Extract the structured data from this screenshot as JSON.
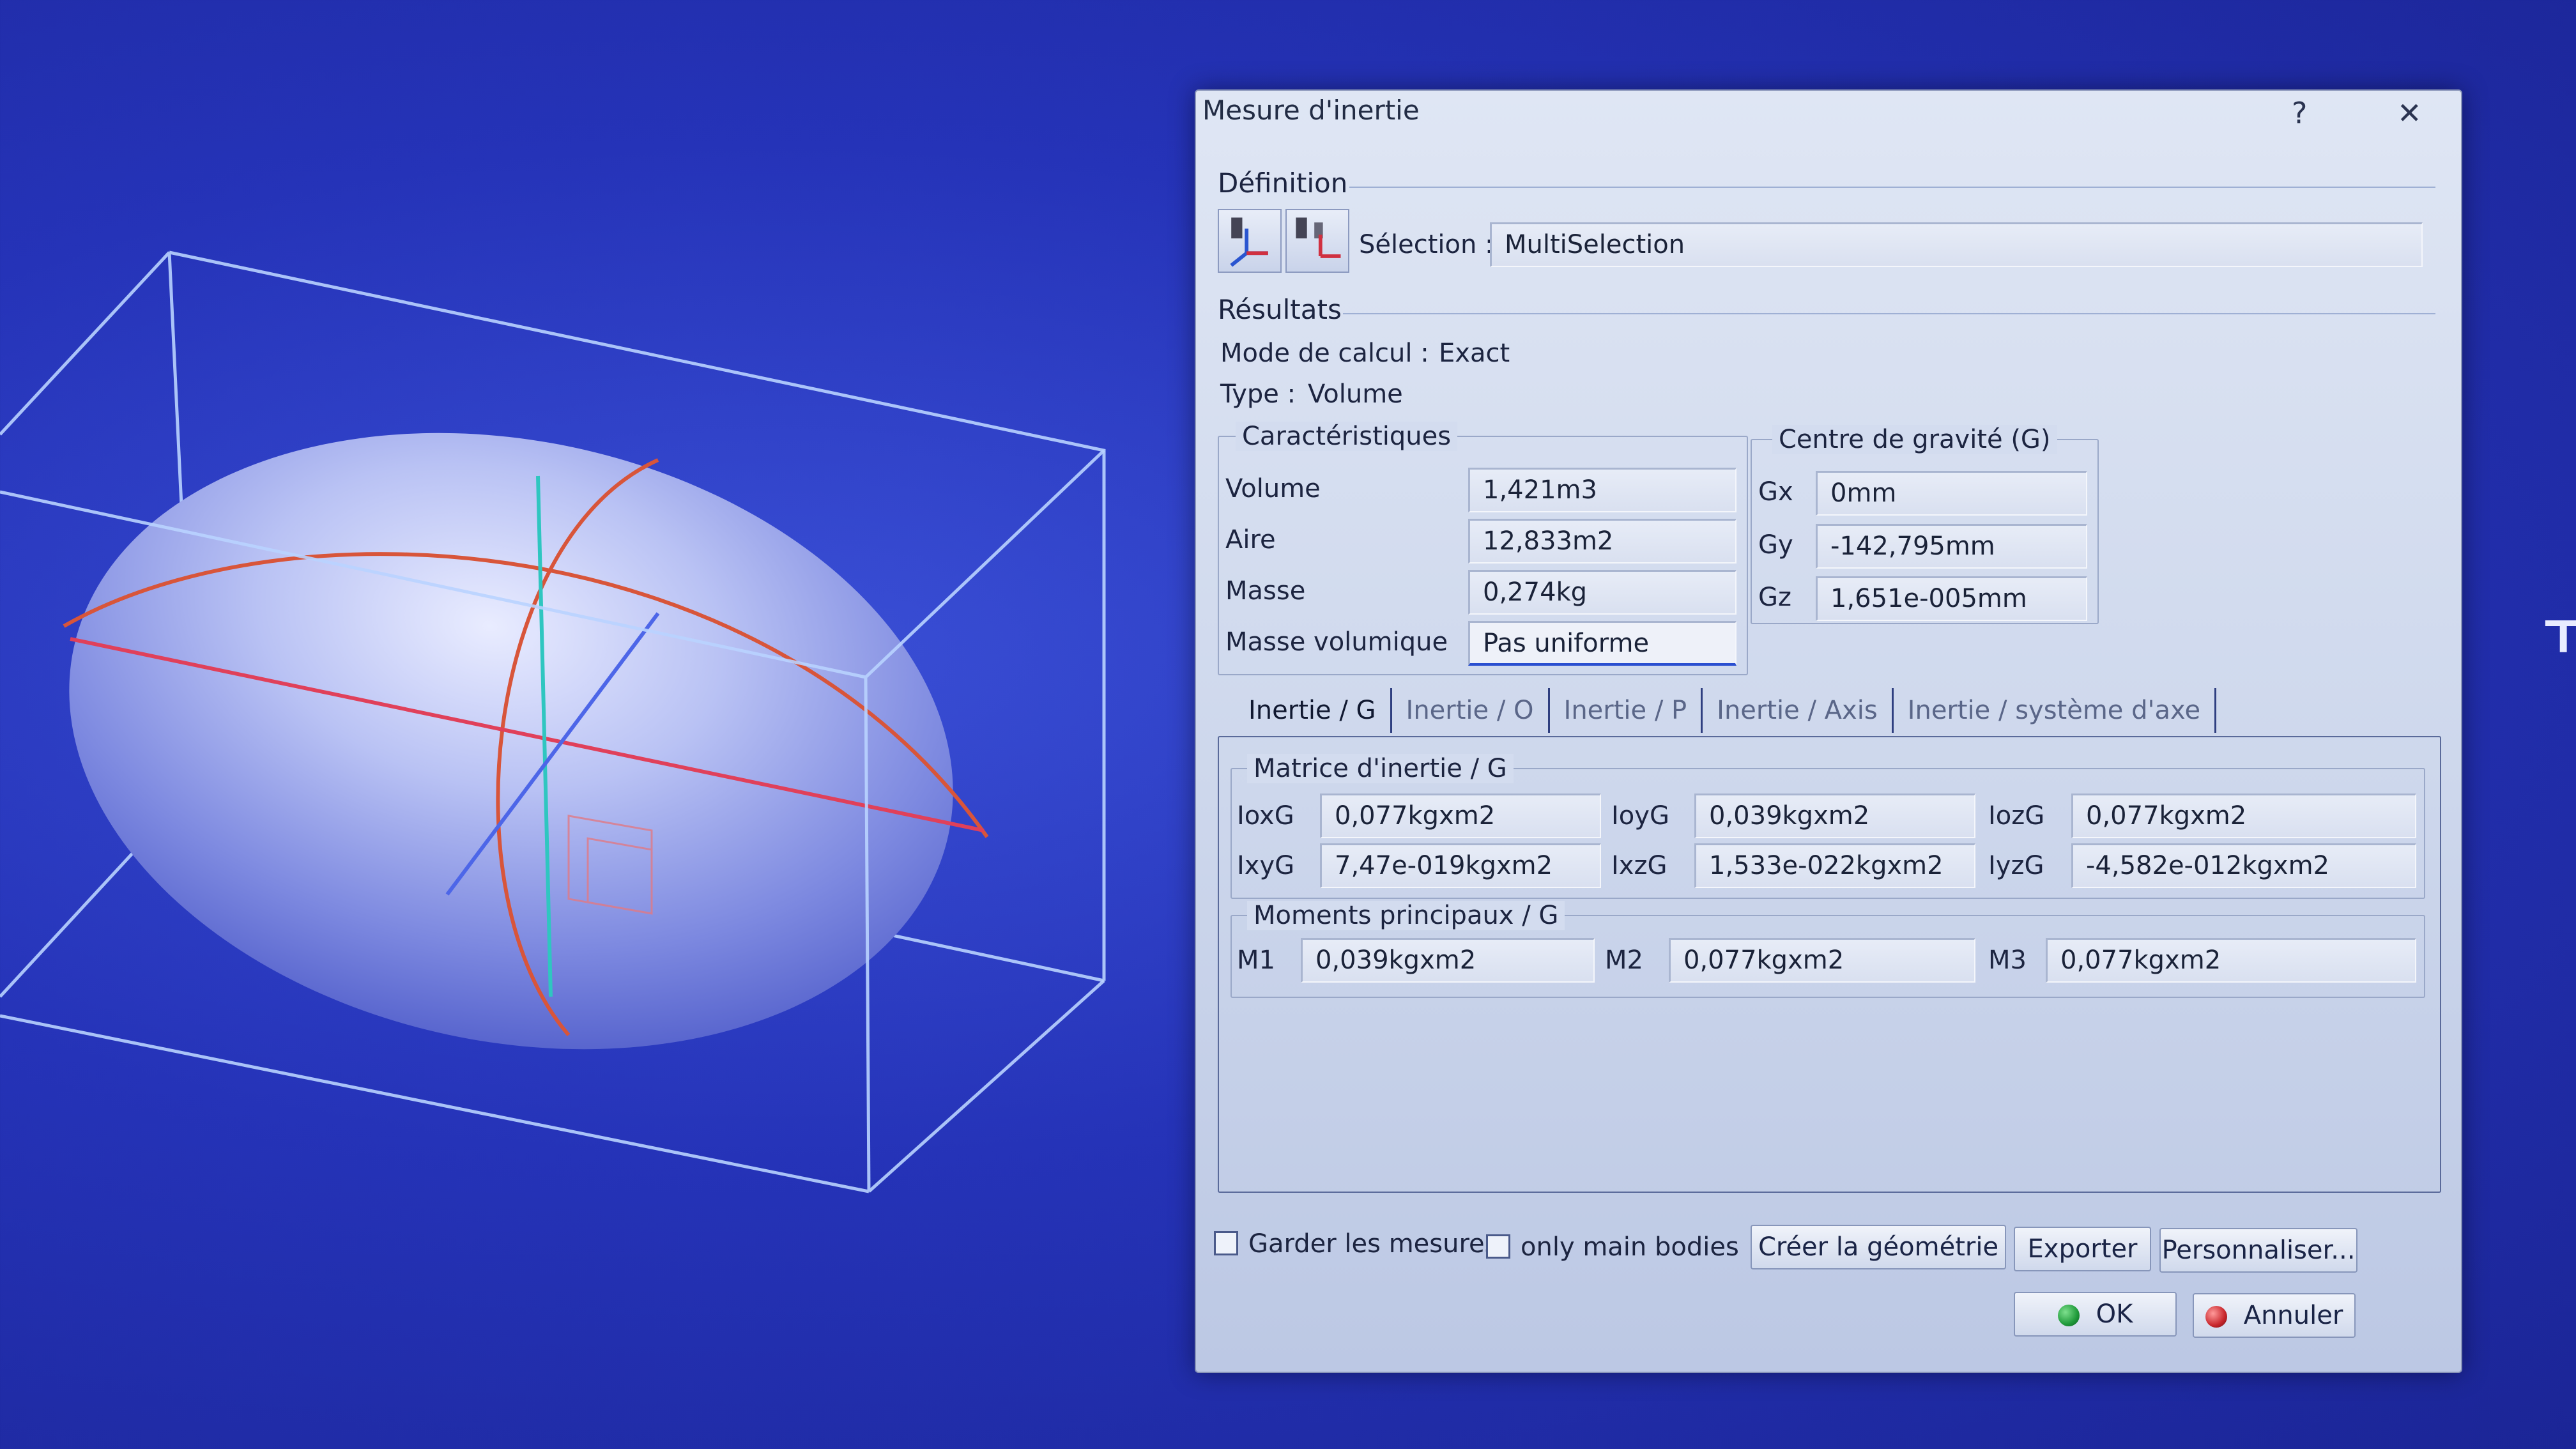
{
  "dialog": {
    "title": "Mesure d'inertie",
    "help_label": "?",
    "close_label": "✕"
  },
  "definition": {
    "label": "Définition",
    "selection_label": "Sélection :",
    "selection_value": "MultiSelection"
  },
  "results": {
    "label": "Résultats",
    "mode_label": "Mode de calcul :",
    "mode_value": "Exact",
    "type_label": "Type :",
    "type_value": "Volume"
  },
  "characteristics": {
    "title": "Caractéristiques",
    "rows": [
      {
        "label": "Volume",
        "value": "1,421m3"
      },
      {
        "label": "Aire",
        "value": "12,833m2"
      },
      {
        "label": "Masse",
        "value": "0,274kg"
      },
      {
        "label": "Masse volumique",
        "value": "Pas uniforme"
      }
    ]
  },
  "gravity": {
    "title": "Centre de gravité (G)",
    "rows": [
      {
        "label": "Gx",
        "value": "0mm"
      },
      {
        "label": "Gy",
        "value": "-142,795mm"
      },
      {
        "label": "Gz",
        "value": "1,651e-005mm"
      }
    ]
  },
  "tabs": [
    {
      "label": "Inertie / G",
      "selected": true
    },
    {
      "label": "Inertie / O"
    },
    {
      "label": "Inertie / P"
    },
    {
      "label": "Inertie / Axis"
    },
    {
      "label": "Inertie / système d'axe"
    }
  ],
  "matrix": {
    "title": "Matrice d'inertie / G",
    "row1": [
      {
        "label": "IoxG",
        "value": "0,077kgxm2"
      },
      {
        "label": "IoyG",
        "value": "0,039kgxm2"
      },
      {
        "label": "IozG",
        "value": "0,077kgxm2"
      }
    ],
    "row2": [
      {
        "label": "IxyG",
        "value": "7,47e-019kgxm2"
      },
      {
        "label": "IxzG",
        "value": "1,533e-022kgxm2"
      },
      {
        "label": "IyzG",
        "value": "-4,582e-012kgxm2"
      }
    ]
  },
  "moments": {
    "title": "Moments principaux / G",
    "items": [
      {
        "label": "M1",
        "value": "0,039kgxm2"
      },
      {
        "label": "M2",
        "value": "0,077kgxm2"
      },
      {
        "label": "M3",
        "value": "0,077kgxm2"
      }
    ]
  },
  "footer": {
    "keep_measures": "Garder les mesures",
    "only_main_bodies": "only main bodies",
    "create_geometry": "Créer la géométrie",
    "export": "Exporter",
    "customize": "Personnaliser...",
    "ok": "OK",
    "cancel": "Annuler"
  },
  "colors": {
    "ok_dot": "#1f9a3a",
    "cancel_dot": "#c8262c"
  }
}
